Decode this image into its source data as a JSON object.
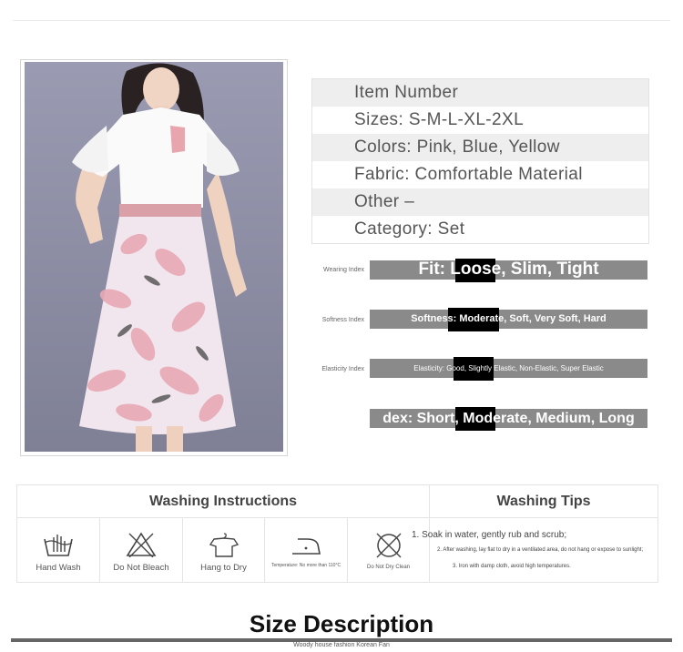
{
  "spec_table": {
    "rows": [
      "Item Number",
      "Sizes: S-M-L-XL-2XL",
      "Colors: Pink, Blue, Yellow",
      "Fabric: Comfortable Material",
      "Other     –",
      "Category: Set"
    ]
  },
  "indices": [
    {
      "label": "Wearing Index",
      "text": "Fit: Loose, Slim, Tight",
      "selected": "Slim"
    },
    {
      "label": "Softness Index",
      "text": "Softness: Moderate, Soft, Very Soft, Hard",
      "selected": "Moderate"
    },
    {
      "label": "Elasticity Index",
      "text": "Elasticity: Good, Slightly Elastic, Non-Elastic, Super Elastic",
      "selected": "Slightly Elastic"
    },
    {
      "label": "",
      "text": "dex: Short, Moderate, Medium, Long",
      "selected": "Moderate"
    }
  ],
  "washing": {
    "instructions_title": "Washing Instructions",
    "tips_title": "Washing Tips",
    "icons": [
      {
        "icon": "hand-wash-icon",
        "label": "Hand Wash"
      },
      {
        "icon": "no-bleach-icon",
        "label": "Do Not Bleach"
      },
      {
        "icon": "hang-to-dry-icon",
        "label": "Hang to Dry"
      },
      {
        "icon": "iron-icon",
        "label": "Temperature: No more than 110°C"
      },
      {
        "icon": "no-dry-clean-icon",
        "label": "Do Not Dry Clean"
      }
    ],
    "tips": [
      "1. Soak in water, gently rub and scrub;",
      "2. After washing, lay flat to dry in a ventilated area, do not hang or expose to sunlight;",
      "3. Iron with damp cloth, avoid high temperatures."
    ]
  },
  "size_title": "Size Description",
  "footer": "Woody house fashion Korean Fan",
  "colors": {
    "bar": "#8a8a8a",
    "alt_row": "#eeeeee",
    "photo_bg": "#8c8da3",
    "skirt_pink": "#e8a9b4"
  }
}
